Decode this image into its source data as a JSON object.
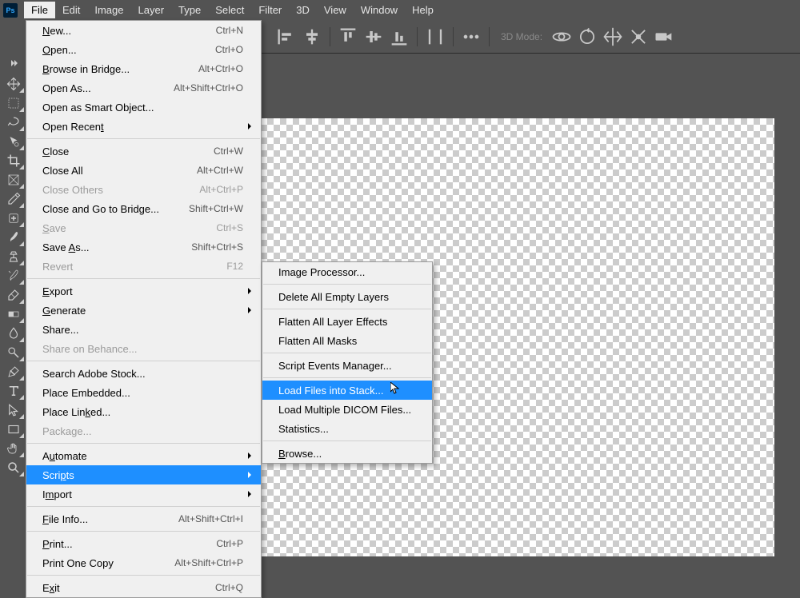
{
  "menubar": [
    "File",
    "Edit",
    "Image",
    "Layer",
    "Type",
    "Select",
    "Filter",
    "3D",
    "View",
    "Window",
    "Help"
  ],
  "menubar_open_index": 0,
  "optionsbar": {
    "mode_label": "3D Mode:"
  },
  "file_menu": {
    "groups": [
      [
        {
          "label": "New...",
          "shortcut": "Ctrl+N",
          "u": 0
        },
        {
          "label": "Open...",
          "shortcut": "Ctrl+O",
          "u": 0
        },
        {
          "label": "Browse in Bridge...",
          "shortcut": "Alt+Ctrl+O",
          "u": 0
        },
        {
          "label": "Open As...",
          "shortcut": "Alt+Shift+Ctrl+O"
        },
        {
          "label": "Open as Smart Object..."
        },
        {
          "label": "Open Recent",
          "submenu": true,
          "u": 10
        }
      ],
      [
        {
          "label": "Close",
          "shortcut": "Ctrl+W",
          "u": 0
        },
        {
          "label": "Close All",
          "shortcut": "Alt+Ctrl+W"
        },
        {
          "label": "Close Others",
          "shortcut": "Alt+Ctrl+P",
          "disabled": true
        },
        {
          "label": "Close and Go to Bridge...",
          "shortcut": "Shift+Ctrl+W"
        },
        {
          "label": "Save",
          "shortcut": "Ctrl+S",
          "disabled": true,
          "u": 0
        },
        {
          "label": "Save As...",
          "shortcut": "Shift+Ctrl+S",
          "u": 5
        },
        {
          "label": "Revert",
          "shortcut": "F12",
          "disabled": true
        }
      ],
      [
        {
          "label": "Export",
          "submenu": true,
          "u": 0
        },
        {
          "label": "Generate",
          "submenu": true,
          "u": 0
        },
        {
          "label": "Share..."
        },
        {
          "label": "Share on Behance...",
          "disabled": true
        }
      ],
      [
        {
          "label": "Search Adobe Stock..."
        },
        {
          "label": "Place Embedded..."
        },
        {
          "label": "Place Linked...",
          "u": 9
        },
        {
          "label": "Package...",
          "disabled": true
        }
      ],
      [
        {
          "label": "Automate",
          "submenu": true,
          "u": 1
        },
        {
          "label": "Scripts",
          "submenu": true,
          "highlight": true,
          "u": 4
        },
        {
          "label": "Import",
          "submenu": true,
          "u": 1
        }
      ],
      [
        {
          "label": "File Info...",
          "shortcut": "Alt+Shift+Ctrl+I",
          "u": 0
        }
      ],
      [
        {
          "label": "Print...",
          "shortcut": "Ctrl+P",
          "u": 0
        },
        {
          "label": "Print One Copy",
          "shortcut": "Alt+Shift+Ctrl+P"
        }
      ],
      [
        {
          "label": "Exit",
          "shortcut": "Ctrl+Q",
          "u": 1
        }
      ]
    ]
  },
  "scripts_menu": {
    "groups": [
      [
        {
          "label": "Image Processor..."
        }
      ],
      [
        {
          "label": "Delete All Empty Layers"
        }
      ],
      [
        {
          "label": "Flatten All Layer Effects"
        },
        {
          "label": "Flatten All Masks"
        }
      ],
      [
        {
          "label": "Script Events Manager..."
        }
      ],
      [
        {
          "label": "Load Files into Stack...",
          "highlight": true
        },
        {
          "label": "Load Multiple DICOM Files..."
        },
        {
          "label": "Statistics..."
        }
      ],
      [
        {
          "label": "Browse...",
          "u": 0
        }
      ]
    ]
  },
  "tools": [
    "move",
    "marquee",
    "lasso",
    "quick-select",
    "crop",
    "frame",
    "eyedropper",
    "spot-heal",
    "brush",
    "clone-stamp",
    "history-brush",
    "eraser",
    "gradient",
    "blur",
    "dodge",
    "pen",
    "type",
    "path-select",
    "rectangle",
    "hand",
    "zoom"
  ]
}
